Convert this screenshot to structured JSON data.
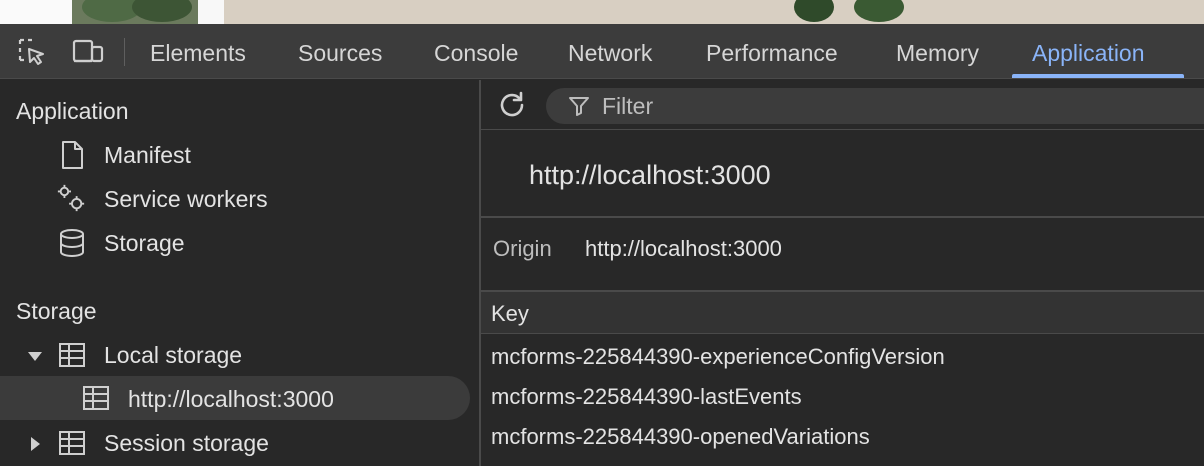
{
  "tabs": [
    "Elements",
    "Sources",
    "Console",
    "Network",
    "Performance",
    "Memory",
    "Application"
  ],
  "active_tab": "Application",
  "sidebar": {
    "application_title": "Application",
    "application_items": [
      {
        "label": "Manifest",
        "icon": "document-icon"
      },
      {
        "label": "Service workers",
        "icon": "gears-icon"
      },
      {
        "label": "Storage",
        "icon": "database-icon"
      }
    ],
    "storage_title": "Storage",
    "storage_items": [
      {
        "label": "Local storage",
        "icon": "table-icon",
        "expanded": true
      },
      {
        "label": "http://localhost:3000",
        "icon": "table-icon",
        "selected": true
      },
      {
        "label": "Session storage",
        "icon": "table-icon",
        "expanded": false
      }
    ]
  },
  "main": {
    "filter_placeholder": "Filter",
    "origin_heading": "http://localhost:3000",
    "origin_label": "Origin",
    "origin_value": "http://localhost:3000",
    "table_header": "Key",
    "rows": [
      "mcforms-225844390-experienceConfigVersion",
      "mcforms-225844390-lastEvents",
      "mcforms-225844390-openedVariations"
    ]
  },
  "colors": {
    "accent": "#8ab4f8",
    "background": "#282828",
    "toolbar": "#3c3c3c"
  }
}
